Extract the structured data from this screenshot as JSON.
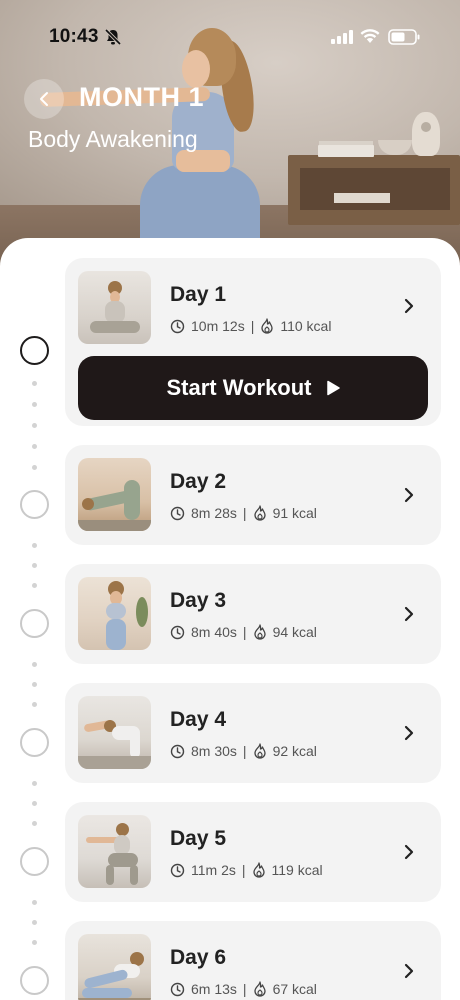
{
  "status_bar": {
    "time": "10:43"
  },
  "header": {
    "title": "MONTH 1",
    "subtitle": "Body Awakening"
  },
  "workout": {
    "start_label": "Start Workout"
  },
  "days": [
    {
      "title": "Day 1",
      "duration": "10m 12s",
      "calories": "110 kcal"
    },
    {
      "title": "Day 2",
      "duration": "8m 28s",
      "calories": "91 kcal"
    },
    {
      "title": "Day 3",
      "duration": "8m 40s",
      "calories": "94 kcal"
    },
    {
      "title": "Day 4",
      "duration": "8m 30s",
      "calories": "92 kcal"
    },
    {
      "title": "Day 5",
      "duration": "11m 2s",
      "calories": "119 kcal"
    },
    {
      "title": "Day 6",
      "duration": "6m 13s",
      "calories": "67 kcal"
    }
  ],
  "icons": {
    "back": "chevron-left-icon",
    "duration": "clock-icon",
    "calories": "flame-icon",
    "open": "chevron-right-icon",
    "play": "play-icon"
  },
  "colors": {
    "accent": "#1f1818",
    "card": "#f3f3f3",
    "text": "#222222"
  }
}
